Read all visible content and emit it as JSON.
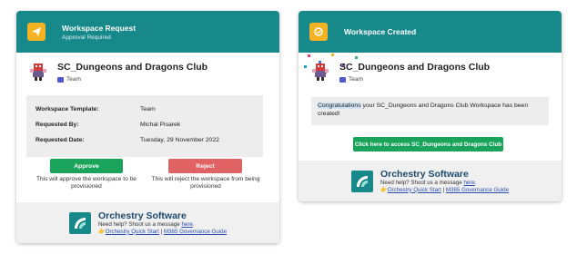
{
  "request_card": {
    "title": "Workspace Request",
    "subtitle": "Approval Required",
    "workspace_name": "SC_Dungeons and Dragons Club",
    "workspace_type": "Team",
    "details": [
      {
        "label": "Workspace Template:",
        "value": "Team"
      },
      {
        "label": "Requested By:",
        "value": "Michal Pisarek"
      },
      {
        "label": "Requested Date:",
        "value": "Tuesday, 29 November 2022"
      }
    ],
    "approve_label": "Approve",
    "approve_note": "This will approve the workspace to be provisioned",
    "reject_label": "Reject",
    "reject_note": "This will reject the workspace from being provisioned"
  },
  "created_card": {
    "title": "Workspace Created",
    "workspace_name": "SC_Dungeons and Dragons Club",
    "workspace_type": "Team",
    "message_highlight": "Congratulations",
    "message_rest": " your SC_Dungeons and Dragons Club Workspace has been created!",
    "access_button": "Click here to access SC_Dungeons and Dragons Club"
  },
  "footer": {
    "brand": "Orchestry Software",
    "help_prefix": "Need help? Shoot us a message ",
    "help_link": "here",
    "help_suffix": ".",
    "quick_start": "Orchestry Quick Start",
    "separator": " | ",
    "guide": "M365 Governance Guide"
  },
  "colors": {
    "header_teal": "#17898b",
    "approve_green": "#1aa35a",
    "reject_red": "#e06262",
    "access_green": "#1aa35a",
    "icon_amber": "#f5b323"
  }
}
